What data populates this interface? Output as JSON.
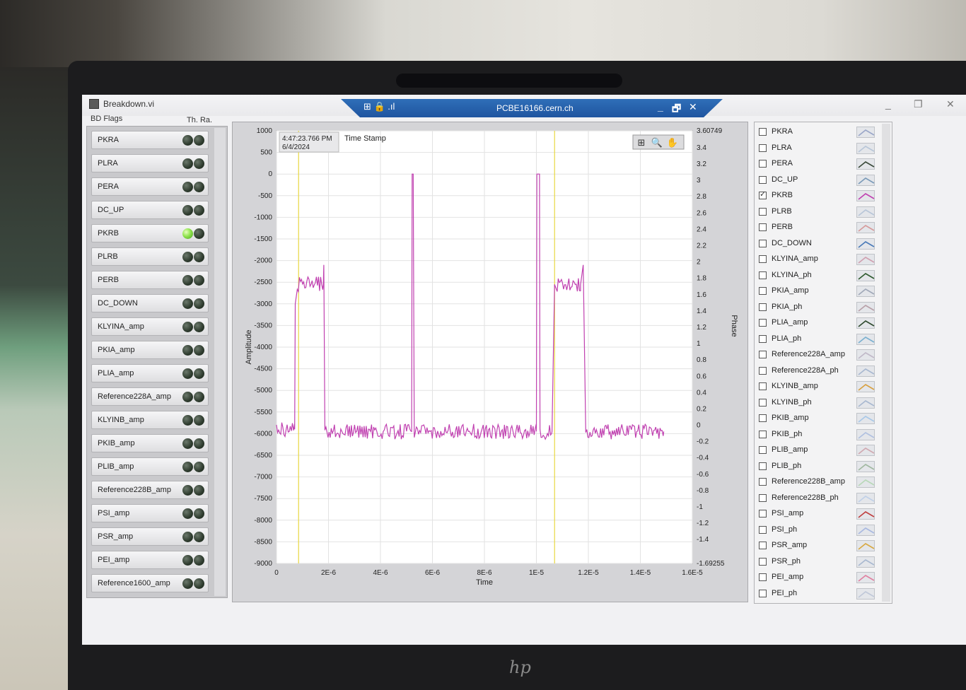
{
  "window": {
    "title": "Breakdown.vi",
    "controls": [
      "_",
      "❐",
      "✕"
    ]
  },
  "remote": {
    "host": "PCBE16166.cern.ch",
    "controls": [
      "_",
      "🗗",
      "✕"
    ]
  },
  "bd_flags": {
    "header": "BD Flags",
    "th_header": "Th. Ra.",
    "items": [
      {
        "label": "PKRA",
        "led1": false,
        "led2": false
      },
      {
        "label": "PLRA",
        "led1": false,
        "led2": false
      },
      {
        "label": "PERA",
        "led1": false,
        "led2": false
      },
      {
        "label": "DC_UP",
        "led1": false,
        "led2": false
      },
      {
        "label": "PKRB",
        "led1": true,
        "led2": false
      },
      {
        "label": "PLRB",
        "led1": false,
        "led2": false
      },
      {
        "label": "PERB",
        "led1": false,
        "led2": false
      },
      {
        "label": "DC_DOWN",
        "led1": false,
        "led2": false
      },
      {
        "label": "KLYINA_amp",
        "led1": false,
        "led2": false
      },
      {
        "label": "PKIA_amp",
        "led1": false,
        "led2": false
      },
      {
        "label": "PLIA_amp",
        "led1": false,
        "led2": false
      },
      {
        "label": "Reference228A_amp",
        "led1": false,
        "led2": false
      },
      {
        "label": "KLYINB_amp",
        "led1": false,
        "led2": false
      },
      {
        "label": "PKIB_amp",
        "led1": false,
        "led2": false
      },
      {
        "label": "PLIB_amp",
        "led1": false,
        "led2": false
      },
      {
        "label": "Reference228B_amp",
        "led1": false,
        "led2": false
      },
      {
        "label": "PSI_amp",
        "led1": false,
        "led2": false
      },
      {
        "label": "PSR_amp",
        "led1": false,
        "led2": false
      },
      {
        "label": "PEI_amp",
        "led1": false,
        "led2": false
      },
      {
        "label": "Reference1600_amp",
        "led1": false,
        "led2": false
      }
    ]
  },
  "graph": {
    "timestamp_time": "4:47:23.766 PM",
    "timestamp_date": "6/4/2024",
    "timestamp_label": "Time Stamp",
    "ylabel_left": "Amplitude",
    "ylabel_right": "Phase",
    "xlabel": "Time",
    "trace_color": "#c040b0",
    "cursor_color": "#e8d840",
    "tools": [
      "crosshair-tool-icon",
      "zoom-tool-icon",
      "pan-tool-icon"
    ]
  },
  "chart_data": {
    "type": "line",
    "xlabel": "Time",
    "ylabel": "Amplitude",
    "y2label": "Phase",
    "xlim": [
      0,
      1.6e-05
    ],
    "ylim": [
      -9000,
      1000
    ],
    "y2lim": [
      -1.69255,
      3.60749
    ],
    "x_ticks": [
      "0",
      "2E-6",
      "4E-6",
      "6E-6",
      "8E-6",
      "1E-5",
      "1.2E-5",
      "1.4E-5",
      "1.6E-5"
    ],
    "y_ticks": [
      "1000",
      "500",
      "0",
      "-500",
      "-1000",
      "-1500",
      "-2000",
      "-2500",
      "-3000",
      "-3500",
      "-4000",
      "-4500",
      "-5000",
      "-5500",
      "-6000",
      "-6500",
      "-7000",
      "-7500",
      "-8000",
      "-8500",
      "-9000"
    ],
    "y2_ticks": [
      "3.60749",
      "3.4",
      "3.2",
      "3",
      "2.8",
      "2.6",
      "2.4",
      "2.2",
      "2",
      "1.8",
      "1.6",
      "1.4",
      "1.2",
      "1",
      "0.8",
      "0.6",
      "0.4",
      "0.2",
      "0",
      "-0.2",
      "-0.4",
      "-0.6",
      "-0.8",
      "-1",
      "-1.2",
      "-1.4",
      "-1.69255"
    ],
    "cursors_x": [
      8.5e-07,
      1.07e-05
    ],
    "series": [
      {
        "x": [
          0,
          7e-07,
          7.2e-07,
          8e-07,
          1.8e-06,
          1.82e-06,
          1.86e-06,
          5.2e-06,
          5.22e-06,
          5.26e-06,
          5.3e-06,
          1e-05,
          1.002e-05,
          1.012e-05,
          1.014e-05,
          1.06e-05,
          1.07e-05,
          1.08e-05,
          1.17e-05,
          1.18e-05,
          1.19e-05,
          1.49e-05
        ],
        "y": [
          -5900,
          -5900,
          -3000,
          -2550,
          -2550,
          -2100,
          -5950,
          -5950,
          0,
          0,
          -5950,
          -5950,
          0,
          0,
          -5950,
          -5950,
          -2550,
          -2550,
          -2550,
          -2100,
          -5950,
          -5950
        ]
      }
    ]
  },
  "legend": {
    "items": [
      {
        "label": "PKRA",
        "checked": false,
        "swatch": "#9aa6c8"
      },
      {
        "label": "PLRA",
        "checked": false,
        "swatch": "#b8c6d8"
      },
      {
        "label": "PERA",
        "checked": false,
        "swatch": "#3a4a3a"
      },
      {
        "label": "DC_UP",
        "checked": false,
        "swatch": "#7a9ab8"
      },
      {
        "label": "PKRB",
        "checked": true,
        "swatch": "#c040b0"
      },
      {
        "label": "PLRB",
        "checked": false,
        "swatch": "#b8c6d8"
      },
      {
        "label": "PERB",
        "checked": false,
        "swatch": "#d69a9a"
      },
      {
        "label": "DC_DOWN",
        "checked": false,
        "swatch": "#4a7ab8"
      },
      {
        "label": "KLYINA_amp",
        "checked": false,
        "swatch": "#d0a0b0"
      },
      {
        "label": "KLYINA_ph",
        "checked": false,
        "swatch": "#2e5a2e"
      },
      {
        "label": "PKIA_amp",
        "checked": false,
        "swatch": "#a0a8b8"
      },
      {
        "label": "PKIA_ph",
        "checked": false,
        "swatch": "#b8a0a8"
      },
      {
        "label": "PLIA_amp",
        "checked": false,
        "swatch": "#2e4a2e"
      },
      {
        "label": "PLIA_ph",
        "checked": false,
        "swatch": "#7ab0d0"
      },
      {
        "label": "Reference228A_amp",
        "checked": false,
        "swatch": "#c0b8c8"
      },
      {
        "label": "Reference228A_ph",
        "checked": false,
        "swatch": "#a8b8d0"
      },
      {
        "label": "KLYINB_amp",
        "checked": false,
        "swatch": "#d8a040"
      },
      {
        "label": "KLYINB_ph",
        "checked": false,
        "swatch": "#a8b8d0"
      },
      {
        "label": "PKIB_amp",
        "checked": false,
        "swatch": "#a8c8e8"
      },
      {
        "label": "PKIB_ph",
        "checked": false,
        "swatch": "#b0c0e0"
      },
      {
        "label": "PLIB_amp",
        "checked": false,
        "swatch": "#d0a8b0"
      },
      {
        "label": "PLIB_ph",
        "checked": false,
        "swatch": "#a0b8a0"
      },
      {
        "label": "Reference228B_amp",
        "checked": false,
        "swatch": "#b8d8b8"
      },
      {
        "label": "Reference228B_ph",
        "checked": false,
        "swatch": "#c0d0e8"
      },
      {
        "label": "PSI_amp",
        "checked": false,
        "swatch": "#c04040"
      },
      {
        "label": "PSI_ph",
        "checked": false,
        "swatch": "#a8b8e0"
      },
      {
        "label": "PSR_amp",
        "checked": false,
        "swatch": "#d8a840"
      },
      {
        "label": "PSR_ph",
        "checked": false,
        "swatch": "#a8b8d0"
      },
      {
        "label": "PEI_amp",
        "checked": false,
        "swatch": "#e080a0"
      },
      {
        "label": "PEI_ph",
        "checked": false,
        "swatch": "#c0c8d8"
      }
    ]
  }
}
